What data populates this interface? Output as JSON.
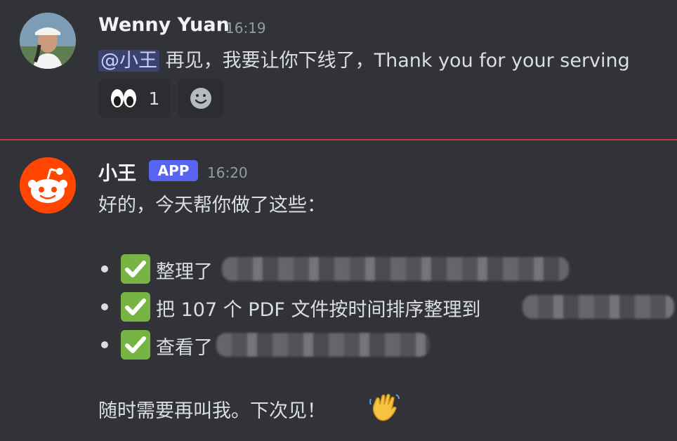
{
  "message1": {
    "author": "Wenny Yuan",
    "timestamp": "16:19",
    "mention": "@小王",
    "text": "再见，我要让你下线了，Thank you for your serving",
    "reactions": [
      {
        "emoji": "eyes-emoji",
        "count": "1"
      },
      {
        "emoji": "add-reaction-icon"
      }
    ]
  },
  "message2": {
    "author": "小王",
    "badge": "APP",
    "timestamp": "16:20",
    "intro": "好的，今天帮你做了这些：",
    "items": [
      {
        "text": "整理了"
      },
      {
        "text": "把 107 个 PDF 文件按时间排序整理到"
      },
      {
        "text": "查看了"
      }
    ],
    "closing": "随时需要再叫我。下次见！"
  },
  "colors": {
    "background": "#313338",
    "divider": "#c23a3a",
    "app_badge": "#5865f2",
    "mention_bg": "#3c4270",
    "check_green": "#76b443",
    "reddit_orange": "#ff4500"
  }
}
